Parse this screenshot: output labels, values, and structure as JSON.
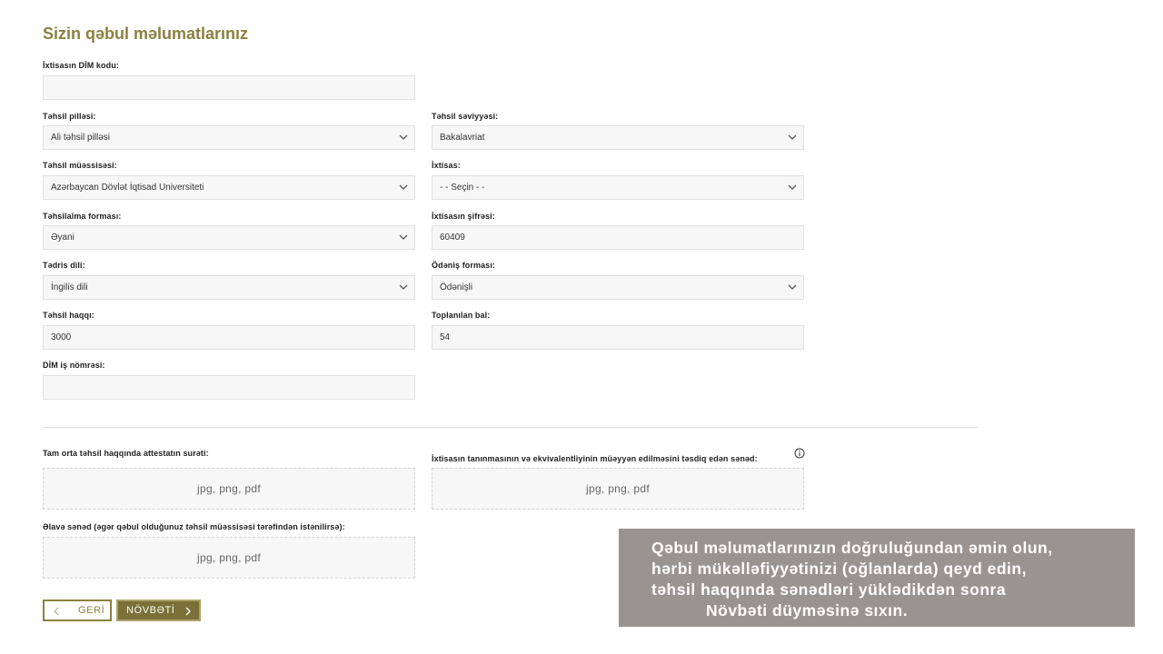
{
  "page": {
    "title": "Sizin qəbul məlumatlarınız"
  },
  "form": {
    "dim_code": {
      "label": "İxtisasın DİM kodu:",
      "value": ""
    },
    "tehsil_pillesi": {
      "label": "Təhsil pilləsi:",
      "value": "Ali təhsil pilləsi"
    },
    "tehsil_seviyyesi": {
      "label": "Təhsil səviyyəsi:",
      "value": "Bakalavriat"
    },
    "tehsil_muessisesi": {
      "label": "Təhsil müəssisəsi:",
      "value": "Azərbaycan Dövlət İqtisad Universiteti"
    },
    "ixtisas": {
      "label": "İxtisas:",
      "value": "- - Seçin - -"
    },
    "tehsilalma_formasi": {
      "label": "Təhsilalma forması:",
      "value": "Əyani"
    },
    "ixtisas_sifresi": {
      "label": "İxtisasın şifrəsi:",
      "value": "60409"
    },
    "tedris_dili": {
      "label": "Tədris dili:",
      "value": "İngilis dili"
    },
    "odenis_formasi": {
      "label": "Ödəniş forması:",
      "value": "Ödənişli"
    },
    "tehsil_haqqi": {
      "label": "Təhsil haqqı:",
      "value": "3000"
    },
    "toplanilan_bal": {
      "label": "Toplanılan bal:",
      "value": "54"
    },
    "dim_is_nomresi": {
      "label": "DİM iş nömrəsi:",
      "value": ""
    }
  },
  "uploads": {
    "attestat": {
      "label": "Tam orta təhsil haqqında attestatın surəti:",
      "hint": "jpg, png, pdf"
    },
    "tanınma": {
      "label": "İxtisasın tanınmasının və ekvivalentliyinin müəyyən edilməsini təsdiq edən sənəd:",
      "hint": "jpg, png, pdf"
    },
    "elave": {
      "label": "Əlavə sənəd (əgər qəbul olduğunuz təhsil müəssisəsi tərəfindən istənilirsə):",
      "hint": "jpg, png, pdf"
    }
  },
  "buttons": {
    "back": "GERİ",
    "next": "NÖVBƏTİ"
  },
  "overlay": {
    "line1": "Qəbul məlumatlarınızın doğruluğundan əmin olun,",
    "line2": "hərbi mükəlləfiyyətinizi (oğlanlarda) qeyd edin,",
    "line3": "təhsil haqqında sənədləri yüklədikdən sonra",
    "line4": "Növbəti düyməsinə sıxın."
  },
  "colors": {
    "accent": "#8a8140",
    "button_bg": "#7a7038",
    "overlay_bg": "#9a9490"
  },
  "icons": {
    "dropdown": "chevron-down-icon",
    "info": "info-icon",
    "back": "chevron-left-icon",
    "next": "chevron-right-icon"
  }
}
